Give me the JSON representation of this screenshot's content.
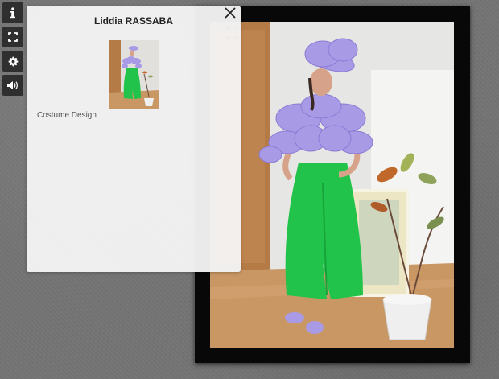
{
  "toolbar": {
    "buttons": [
      {
        "name": "info",
        "icon": "info-icon"
      },
      {
        "name": "fullscreen",
        "icon": "fullscreen-icon"
      },
      {
        "name": "settings",
        "icon": "gear-icon"
      },
      {
        "name": "sound",
        "icon": "speaker-icon"
      }
    ]
  },
  "panel": {
    "title": "Liddia RASSABA",
    "caption": "Costume Design",
    "close_icon": "close-icon"
  },
  "artwork": {
    "fullscreen_icon": "fullscreen-icon"
  },
  "colors": {
    "toolbar_bg": "#2f2f2f",
    "panel_bg": "#f4f4f4",
    "frame": "#080808",
    "costume_green": "#22c34a",
    "costume_lavender": "#a99ae6"
  }
}
